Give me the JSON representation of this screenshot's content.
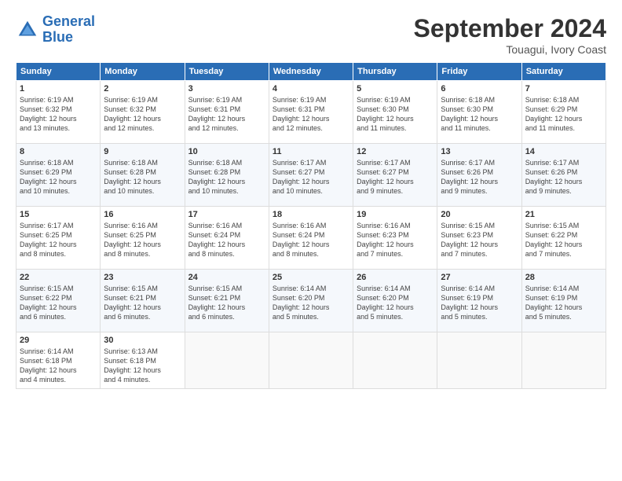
{
  "header": {
    "logo_line1": "General",
    "logo_line2": "Blue",
    "month": "September 2024",
    "location": "Touagui, Ivory Coast"
  },
  "weekdays": [
    "Sunday",
    "Monday",
    "Tuesday",
    "Wednesday",
    "Thursday",
    "Friday",
    "Saturday"
  ],
  "weeks": [
    [
      {
        "day": "1",
        "info": "Sunrise: 6:19 AM\nSunset: 6:32 PM\nDaylight: 12 hours\nand 13 minutes."
      },
      {
        "day": "2",
        "info": "Sunrise: 6:19 AM\nSunset: 6:32 PM\nDaylight: 12 hours\nand 12 minutes."
      },
      {
        "day": "3",
        "info": "Sunrise: 6:19 AM\nSunset: 6:31 PM\nDaylight: 12 hours\nand 12 minutes."
      },
      {
        "day": "4",
        "info": "Sunrise: 6:19 AM\nSunset: 6:31 PM\nDaylight: 12 hours\nand 12 minutes."
      },
      {
        "day": "5",
        "info": "Sunrise: 6:19 AM\nSunset: 6:30 PM\nDaylight: 12 hours\nand 11 minutes."
      },
      {
        "day": "6",
        "info": "Sunrise: 6:18 AM\nSunset: 6:30 PM\nDaylight: 12 hours\nand 11 minutes."
      },
      {
        "day": "7",
        "info": "Sunrise: 6:18 AM\nSunset: 6:29 PM\nDaylight: 12 hours\nand 11 minutes."
      }
    ],
    [
      {
        "day": "8",
        "info": "Sunrise: 6:18 AM\nSunset: 6:29 PM\nDaylight: 12 hours\nand 10 minutes."
      },
      {
        "day": "9",
        "info": "Sunrise: 6:18 AM\nSunset: 6:28 PM\nDaylight: 12 hours\nand 10 minutes."
      },
      {
        "day": "10",
        "info": "Sunrise: 6:18 AM\nSunset: 6:28 PM\nDaylight: 12 hours\nand 10 minutes."
      },
      {
        "day": "11",
        "info": "Sunrise: 6:17 AM\nSunset: 6:27 PM\nDaylight: 12 hours\nand 10 minutes."
      },
      {
        "day": "12",
        "info": "Sunrise: 6:17 AM\nSunset: 6:27 PM\nDaylight: 12 hours\nand 9 minutes."
      },
      {
        "day": "13",
        "info": "Sunrise: 6:17 AM\nSunset: 6:26 PM\nDaylight: 12 hours\nand 9 minutes."
      },
      {
        "day": "14",
        "info": "Sunrise: 6:17 AM\nSunset: 6:26 PM\nDaylight: 12 hours\nand 9 minutes."
      }
    ],
    [
      {
        "day": "15",
        "info": "Sunrise: 6:17 AM\nSunset: 6:25 PM\nDaylight: 12 hours\nand 8 minutes."
      },
      {
        "day": "16",
        "info": "Sunrise: 6:16 AM\nSunset: 6:25 PM\nDaylight: 12 hours\nand 8 minutes."
      },
      {
        "day": "17",
        "info": "Sunrise: 6:16 AM\nSunset: 6:24 PM\nDaylight: 12 hours\nand 8 minutes."
      },
      {
        "day": "18",
        "info": "Sunrise: 6:16 AM\nSunset: 6:24 PM\nDaylight: 12 hours\nand 8 minutes."
      },
      {
        "day": "19",
        "info": "Sunrise: 6:16 AM\nSunset: 6:23 PM\nDaylight: 12 hours\nand 7 minutes."
      },
      {
        "day": "20",
        "info": "Sunrise: 6:15 AM\nSunset: 6:23 PM\nDaylight: 12 hours\nand 7 minutes."
      },
      {
        "day": "21",
        "info": "Sunrise: 6:15 AM\nSunset: 6:22 PM\nDaylight: 12 hours\nand 7 minutes."
      }
    ],
    [
      {
        "day": "22",
        "info": "Sunrise: 6:15 AM\nSunset: 6:22 PM\nDaylight: 12 hours\nand 6 minutes."
      },
      {
        "day": "23",
        "info": "Sunrise: 6:15 AM\nSunset: 6:21 PM\nDaylight: 12 hours\nand 6 minutes."
      },
      {
        "day": "24",
        "info": "Sunrise: 6:15 AM\nSunset: 6:21 PM\nDaylight: 12 hours\nand 6 minutes."
      },
      {
        "day": "25",
        "info": "Sunrise: 6:14 AM\nSunset: 6:20 PM\nDaylight: 12 hours\nand 5 minutes."
      },
      {
        "day": "26",
        "info": "Sunrise: 6:14 AM\nSunset: 6:20 PM\nDaylight: 12 hours\nand 5 minutes."
      },
      {
        "day": "27",
        "info": "Sunrise: 6:14 AM\nSunset: 6:19 PM\nDaylight: 12 hours\nand 5 minutes."
      },
      {
        "day": "28",
        "info": "Sunrise: 6:14 AM\nSunset: 6:19 PM\nDaylight: 12 hours\nand 5 minutes."
      }
    ],
    [
      {
        "day": "29",
        "info": "Sunrise: 6:14 AM\nSunset: 6:18 PM\nDaylight: 12 hours\nand 4 minutes."
      },
      {
        "day": "30",
        "info": "Sunrise: 6:13 AM\nSunset: 6:18 PM\nDaylight: 12 hours\nand 4 minutes."
      },
      {
        "day": "",
        "info": ""
      },
      {
        "day": "",
        "info": ""
      },
      {
        "day": "",
        "info": ""
      },
      {
        "day": "",
        "info": ""
      },
      {
        "day": "",
        "info": ""
      }
    ]
  ]
}
